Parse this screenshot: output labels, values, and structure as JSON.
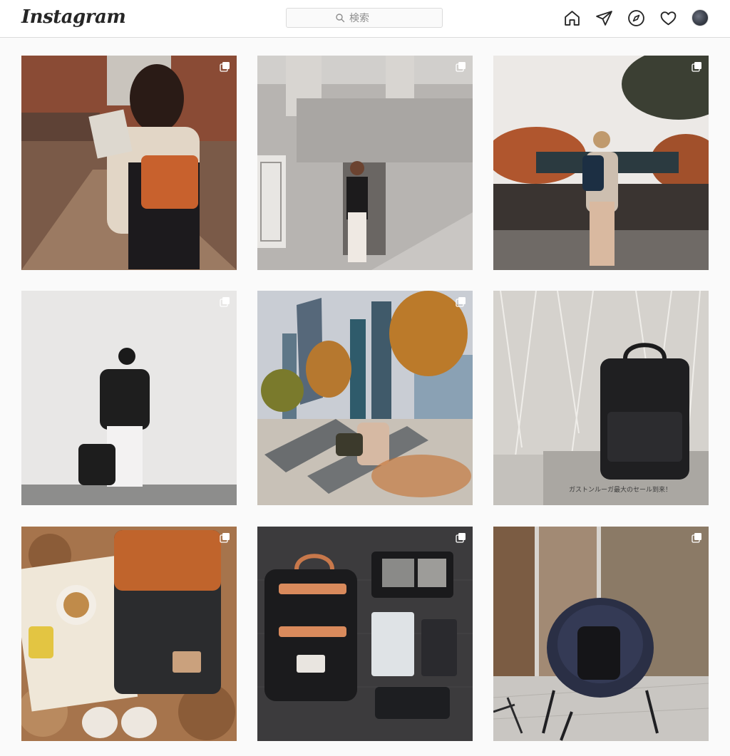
{
  "header": {
    "logo_text": "Instagram",
    "search_placeholder": "検索"
  },
  "nav_icons": [
    "home-icon",
    "direct-message-icon",
    "explore-icon",
    "heart-icon",
    "profile-avatar"
  ],
  "posts": [
    {
      "subject": "woman with map and brown leather backpack on dirt road",
      "multi": true
    },
    {
      "subject": "woman with small black backpack beside stone building",
      "multi": true
    },
    {
      "subject": "man with blue backpack leaning on wall by autumn trees",
      "multi": true
    },
    {
      "subject": "person in bucket hat holding black backpack by white wall",
      "multi": true
    },
    {
      "subject": "woman on lounge bench with backpack near city towers",
      "multi": true
    },
    {
      "subject": "black backpack on sofa in front of lace curtain",
      "multi": false,
      "overlay_text": "ガストンルーガ最大のセール到来！"
    },
    {
      "subject": "brown and black backpack flat lay on autumn leaves",
      "multi": true
    },
    {
      "subject": "black backpack with stationery flat lay on dark floor",
      "multi": true
    },
    {
      "subject": "black backpack on round patio chair",
      "multi": true
    }
  ],
  "colors": {
    "header_bg": "#ffffff",
    "page_bg": "#fafafa",
    "border": "#dbdbdb",
    "icon": "#262626"
  }
}
